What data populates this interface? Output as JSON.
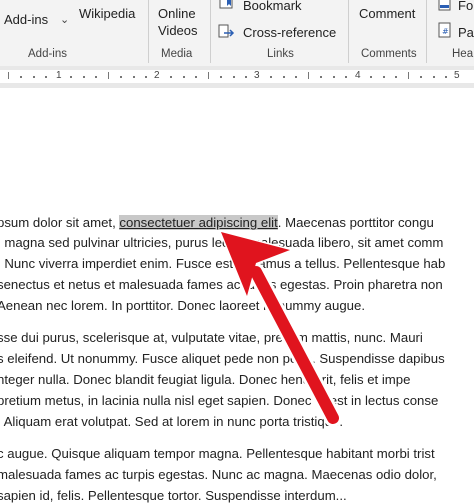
{
  "ribbon": {
    "addins_button": "Add-ins",
    "wikipedia_button": "Wikipedia",
    "addins_group": "Add-ins",
    "online_videos_line1": "Online",
    "online_videos_line2": "Videos",
    "media_group": "Media",
    "bookmark_button": "Bookmark",
    "crossref_button": "Cross-reference",
    "links_group": "Links",
    "comment_button": "Comment",
    "comments_group": "Comments",
    "header_group_partial": "Hea",
    "footer_partial": "Fo",
    "page_number_partial": "Pa"
  },
  "ruler": {
    "numbers": [
      "1",
      "2",
      "3",
      "4",
      "5"
    ]
  },
  "document": {
    "paragraph1": [
      {
        "before": "psum dolor sit amet, ",
        "selected": "consectetuer adipiscing elit",
        "after": ". Maecenas porttitor congu"
      },
      {
        "text": ", magna sed pulvinar ultricies, purus lectus malesuada libero, sit amet comm"
      },
      {
        "text": ". Nunc viverra imperdiet enim. Fusce est. Vivamus a tellus. Pellentesque hab"
      },
      {
        "text": " senectus et netus et malesuada fames ac turpis egestas. Proin pharetra non"
      },
      {
        "text": "Aenean nec lorem. In porttitor. Donec laoreet nonummy augue."
      }
    ],
    "paragraph2": [
      "sse dui purus, scelerisque at, vulputate vitae, pretium mattis, nunc. Mauri",
      "s eleifend. Ut nonummy. Fusce aliquet pede non pede. Suspendisse dapibus",
      "nteger nulla. Donec blandit feugiat ligula. Donec hendrerit, felis et impe",
      "pretium metus, in lacinia nulla nisl eget sapien. Donec ut est in lectus conse",
      ". Aliquam erat volutpat. Sed at lorem in nunc porta tristique."
    ],
    "paragraph3": [
      "c augue. Quisque aliquam tempor magna. Pellentesque habitant morbi trist",
      "malesuada fames ac turpis egestas. Nunc ac magna. Maecenas odio dolor,",
      "sapien id, felis. Pellentesque tortor. Suspendisse interdum..."
    ]
  },
  "annotation": {
    "arrow_color": "#e0141e"
  }
}
